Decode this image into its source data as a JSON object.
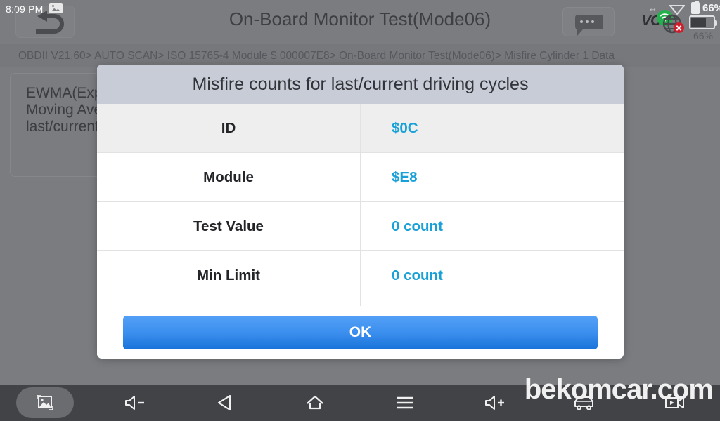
{
  "statusbar": {
    "clock": "8:09 PM",
    "image_icon": "image-icon",
    "vci_label": "VCI",
    "wifi_icon": "wifi-icon",
    "globe_icon": "globe-disconnected-icon",
    "arrows_icon": "↔",
    "battery_percent_top": "66%",
    "battery_percent_bottom": "66%",
    "battery_level": 66
  },
  "header": {
    "title": "On-Board Monitor Test(Mode06)",
    "back_icon": "back-arrow-icon",
    "chat_icon": "chat-bubble-icon"
  },
  "breadcrumb": {
    "text": "OBDII V21.60> AUTO SCAN> ISO 15765-4 Module $ 000007E8> On-Board Monitor Test(Mode06)> Misfire Cylinder 1 Data"
  },
  "background_panel": {
    "text": "EWMA(Exponentially Weighted Moving Average)misfire counts for last/current driving cycles"
  },
  "dialog": {
    "title": "Misfire counts for last/current driving cycles",
    "rows": [
      {
        "label": "ID",
        "value": "$0C"
      },
      {
        "label": "Module",
        "value": "$E8"
      },
      {
        "label": "Test Value",
        "value": "0 count"
      },
      {
        "label": "Min Limit",
        "value": "0 count"
      }
    ],
    "ok_label": "OK"
  },
  "navbar": {
    "items": [
      {
        "name": "screenshot",
        "icon": "screenshot-icon",
        "active": true
      },
      {
        "name": "volume-down",
        "icon": "volume-down-icon",
        "active": false
      },
      {
        "name": "back",
        "icon": "back-triangle-icon",
        "active": false
      },
      {
        "name": "home",
        "icon": "home-icon",
        "active": false
      },
      {
        "name": "menu",
        "icon": "hamburger-menu-icon",
        "active": false
      },
      {
        "name": "volume-up",
        "icon": "volume-up-icon",
        "active": false
      },
      {
        "name": "car",
        "icon": "car-icon",
        "active": false
      },
      {
        "name": "record",
        "icon": "video-record-icon",
        "active": false
      }
    ]
  },
  "watermark": {
    "text": "bekomcar.com"
  },
  "colors": {
    "accent_value": "#18a0d8",
    "button_blue": "#3d90ef",
    "dialog_header": "#c7ccd6",
    "app_background": "#7a7c80",
    "nav_background": "#414347"
  }
}
